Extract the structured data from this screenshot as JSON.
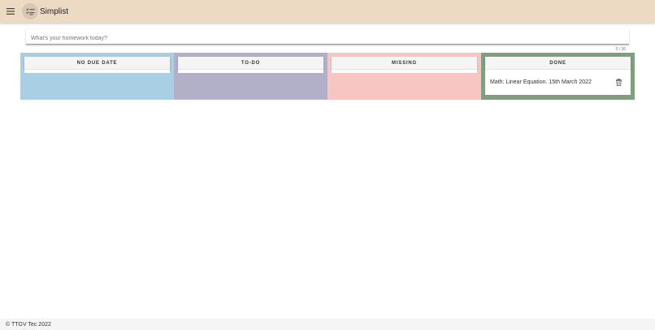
{
  "app": {
    "title": "Simplist",
    "accent_color": "#eddac3"
  },
  "input": {
    "placeholder": "What's your homework today?",
    "value": "",
    "counter": "0 / 36"
  },
  "columns": [
    {
      "label": "NO DUE DATE",
      "color": "#a8cfe4",
      "items": []
    },
    {
      "label": "TO-DO",
      "color": "#b2afc9",
      "items": []
    },
    {
      "label": "MISSING",
      "color": "#f8c6c2",
      "items": []
    },
    {
      "label": "DONE",
      "color": "#7f9f80",
      "items": [
        {
          "text": "Math: Linear Equation. 15th March 2022",
          "action_icon": "trash-icon"
        }
      ]
    }
  ],
  "icons": {
    "menu": "menu-icon",
    "logo": "checklist-icon",
    "delete": "trash-icon"
  },
  "footer": {
    "text": "© TTGV Tec 2022"
  }
}
